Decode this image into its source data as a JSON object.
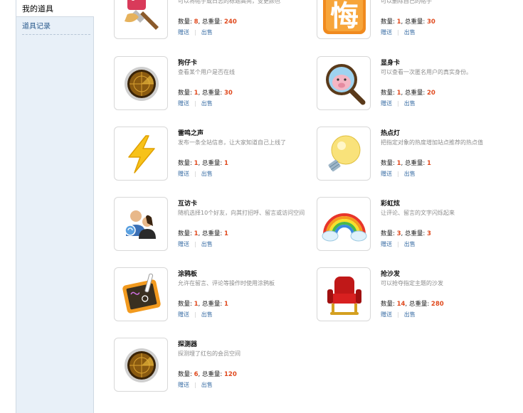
{
  "sidebar": {
    "active_label": "我的道具",
    "link_label": "道具记录"
  },
  "labels": {
    "quantity": "数量: ",
    "total_quantity": "总重量: ",
    "gift": "赠送",
    "sell": "出售",
    "separator": "|",
    "comma": ", "
  },
  "items": [
    {
      "name": "",
      "desc": "可以将帖子或日志的标题高亮，变更颜色",
      "qty": "8",
      "total": "240",
      "icon": "paint-brush-icon"
    },
    {
      "name": "",
      "desc": "可以删除自己的帖子",
      "qty": "1",
      "total": "30",
      "icon": "regret-card-icon"
    },
    {
      "name": "狗仔卡",
      "desc": "查看某个用户是否在线",
      "qty": "1",
      "total": "30",
      "icon": "radar-icon"
    },
    {
      "name": "显身卡",
      "desc": "可以查看一次匿名用户的真实身份。",
      "qty": "1",
      "total": "20",
      "icon": "magnifier-pig-icon"
    },
    {
      "name": "雷鸣之声",
      "desc": "发布一条全站信息，让大家知道自己上线了",
      "qty": "1",
      "total": "1",
      "icon": "lightning-icon"
    },
    {
      "name": "热点灯",
      "desc": "把指定对象的热度增加站点推荐的热点值",
      "qty": "1",
      "total": "1",
      "icon": "light-bulb-icon"
    },
    {
      "name": "互访卡",
      "desc": "随机选择10个好友，向其打招呼、留言或访问空间",
      "qty": "1",
      "total": "1",
      "icon": "friends-icon"
    },
    {
      "name": "彩虹炫",
      "desc": "让评论、留言的文字闪烁起来",
      "qty": "3",
      "total": "3",
      "icon": "rainbow-icon"
    },
    {
      "name": "涂鸦板",
      "desc": "允许在留言、评论等操作时使用涂鸦板",
      "qty": "1",
      "total": "1",
      "icon": "doodle-board-icon"
    },
    {
      "name": "抢沙发",
      "desc": "可以抢夺指定主题的沙发",
      "qty": "14",
      "total": "280",
      "icon": "red-chair-icon"
    },
    {
      "name": "探测器",
      "desc": "探测埋了红包的会员空间",
      "qty": "6",
      "total": "120",
      "icon": "radar-icon"
    }
  ],
  "regret_card_char": "悔"
}
